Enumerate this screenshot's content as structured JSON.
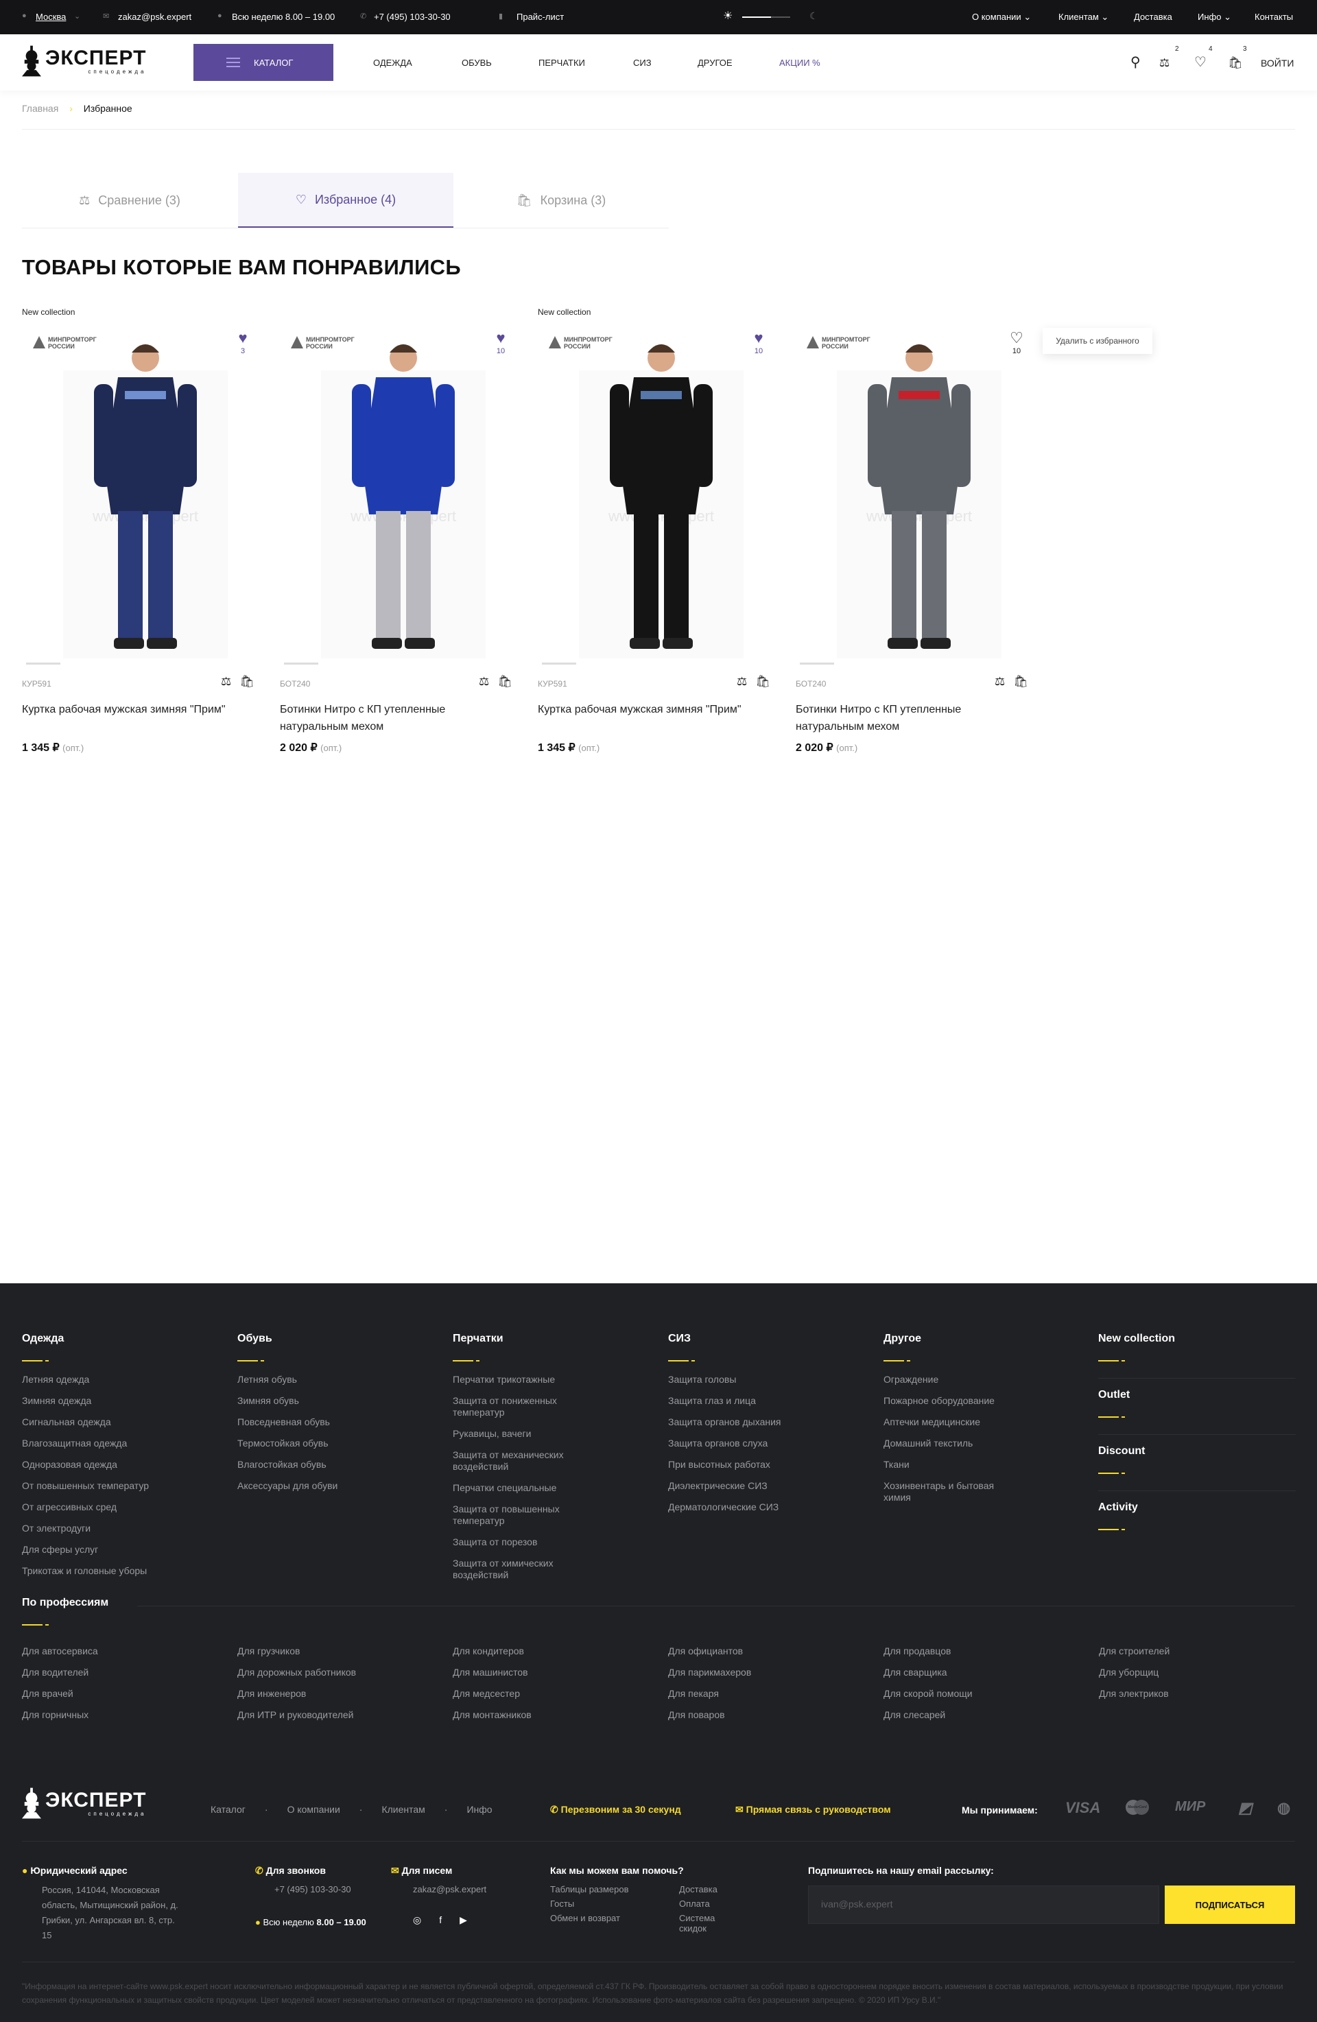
{
  "topbar": {
    "city": "Москва",
    "email": "zakaz@psk.expert",
    "hours": "Всю неделю 8.00 – 19.00",
    "phone": "+7 (495) 103-30-30",
    "pricelist": "Прайс-лист",
    "menu": [
      "О компании",
      "Клиентам",
      "Доставка",
      "Инфо",
      "Контакты"
    ]
  },
  "header": {
    "logo_text": "ЭКСПЕРТ",
    "logo_sub": "спецодежда",
    "catalog": "КАТАЛОГ",
    "nav": [
      "ОДЕЖДА",
      "ОБУВЬ",
      "ПЕРЧАТКИ",
      "СИЗ",
      "ДРУГОЕ",
      "АКЦИИ %"
    ],
    "compare_count": "2",
    "fav_count": "4",
    "cart_count": "3",
    "login": "ВОЙТИ",
    "accent": "#5b4a9b"
  },
  "breadcrumb": {
    "home": "Главная",
    "current": "Избранное"
  },
  "tabs": [
    {
      "label": "Сравнение (3)"
    },
    {
      "label": "Избранное (4)",
      "active": true
    },
    {
      "label": "Корзина (3)"
    }
  ],
  "title": "ТОВАРЫ КОТОРЫЕ ВАМ ПОНРАВИЛИСЬ",
  "watermark": "www.psk.expert",
  "minpromtorg": "МИНПРОМТОРГ РОССИИ",
  "products": [
    {
      "label": "New collection",
      "fav_count": "3",
      "article": "КУР591",
      "name": "Куртка рабочая мужская зимняя \"Прим\"",
      "price": "1 345",
      "currency": "₽",
      "price_note": "(опт.)"
    },
    {
      "label": "",
      "fav_count": "10",
      "article": "БОТ240",
      "name": "Ботинки Нитро с КП утепленные натуральным мехом",
      "price": "2 020",
      "currency": "₽",
      "price_note": "(опт.)"
    },
    {
      "label": "New collection",
      "fav_count": "10",
      "article": "КУР591",
      "name": "Куртка рабочая мужская зимняя \"Прим\"",
      "price": "1 345",
      "currency": "₽",
      "price_note": "(опт.)"
    },
    {
      "label": "",
      "fav_count": "10",
      "article": "БОТ240",
      "name": "Ботинки Нитро с КП утепленные натуральным мехом",
      "price": "2 020",
      "currency": "₽",
      "price_note": "(опт.)"
    }
  ],
  "tooltip": "Удалить с избранного",
  "footer": {
    "columns": [
      {
        "title": "Одежда",
        "items": [
          "Летняя одежда",
          "Зимняя одежда",
          "Сигнальная одежда",
          "Влагозащитная одежда",
          "Одноразовая одежда",
          "От повышенных температур",
          "От агрессивных сред",
          "От электродуги",
          "Для сферы услуг",
          "Трикотаж и головные уборы"
        ]
      },
      {
        "title": "Обувь",
        "items": [
          "Летняя обувь",
          "Зимняя обувь",
          "Повседневная обувь",
          "Термостойкая обувь",
          "Влагостойкая обувь",
          "Аксессуары для обуви"
        ]
      },
      {
        "title": "Перчатки",
        "items": [
          "Перчатки трикотажные",
          "Защита от пониженных температур",
          "Рукавицы, вачеги",
          "Защита от механических воздействий",
          "Перчатки специальные",
          "Защита от повышенных температур",
          "Защита от порезов",
          "Защита от химических воздействий"
        ]
      },
      {
        "title": "СИЗ",
        "items": [
          "Защита головы",
          "Защита глаз и лица",
          "Защита органов дыхания",
          "Защита органов слуха",
          "При высотных работах",
          "Диэлектрические СИЗ",
          "Дерматологические СИЗ"
        ]
      },
      {
        "title": "Другое",
        "items": [
          "Ограждение",
          "Пожарное оборудование",
          "Аптечки медицинские",
          "Домашний текстиль",
          "Ткани",
          "Хозинвентарь и бытовая химия"
        ]
      }
    ],
    "side": [
      "New collection",
      "Outlet",
      "Discount",
      "Activity"
    ],
    "professions_title": "По профессиям",
    "professions": [
      [
        "Для автосервиса",
        "Для водителей",
        "Для врачей",
        "Для горничных"
      ],
      [
        "Для грузчиков",
        "Для дорожных работников",
        "Для инженеров",
        "Для ИТР и руководителей"
      ],
      [
        "Для кондитеров",
        "Для машинистов",
        "Для медсестер",
        "Для монтажников"
      ],
      [
        "Для официантов",
        "Для парикмахеров",
        "Для пекаря",
        "Для поваров"
      ],
      [
        "Для продавцов",
        "Для сварщика",
        "Для скорой помощи",
        "Для слесарей"
      ],
      [
        "Для строителей",
        "Для уборщиц",
        "Для электриков"
      ]
    ],
    "bottom_nav": [
      "Каталог",
      "О компании",
      "Клиентам",
      "Инфо"
    ],
    "callback": "Перезвоним за 30 секунд",
    "direct": "Прямая связь с руководством",
    "we_accept": "Мы принимаем:",
    "payments": [
      "VISA",
      "MasterCard",
      "МИР",
      "Яндекс",
      "WebMoney"
    ],
    "address_title": "Юридический адрес",
    "address": "Россия, 141044, Московская область, Мытищинский район, д. Грибки, ул. Ангарская вл. 8, стр. 15",
    "calls_title": "Для звонков",
    "phone": "+7 (495) 103-30-30",
    "hours_prefix": "Всю неделю",
    "hours": "8.00 – 19.00",
    "mail_title": "Для писем",
    "email": "zakaz@psk.expert",
    "help_title": "Как мы можем вам помочь?",
    "help_links": [
      "Таблицы размеров",
      "Доставка",
      "Госты",
      "Оплата",
      "Обмен и возврат",
      "Система скидок"
    ],
    "subscribe_title": "Подпишитесь на нашу email рассылку:",
    "subscribe_placeholder": "ivan@psk.expert",
    "subscribe_button": "ПОДПИСАТЬСЯ",
    "disclaimer": "\"Информация на интернет-сайте www.psk.expert носит исключительно информационный характер и не является публичной офертой, определяемой ст.437 ГК РФ. Производитель оставляет за собой право в одностороннем порядке вносить изменения в состав материалов, используемых в производстве продукции, при условии сохранения функциональных и защитных свойств продукции. Цвет моделей может незначительно отличаться от представленного на фотографиях. Использование фото-материалов сайта без разрешения запрещено. © 2020 ИП Урсу В.И.\"",
    "accent": "#f5d92a"
  }
}
